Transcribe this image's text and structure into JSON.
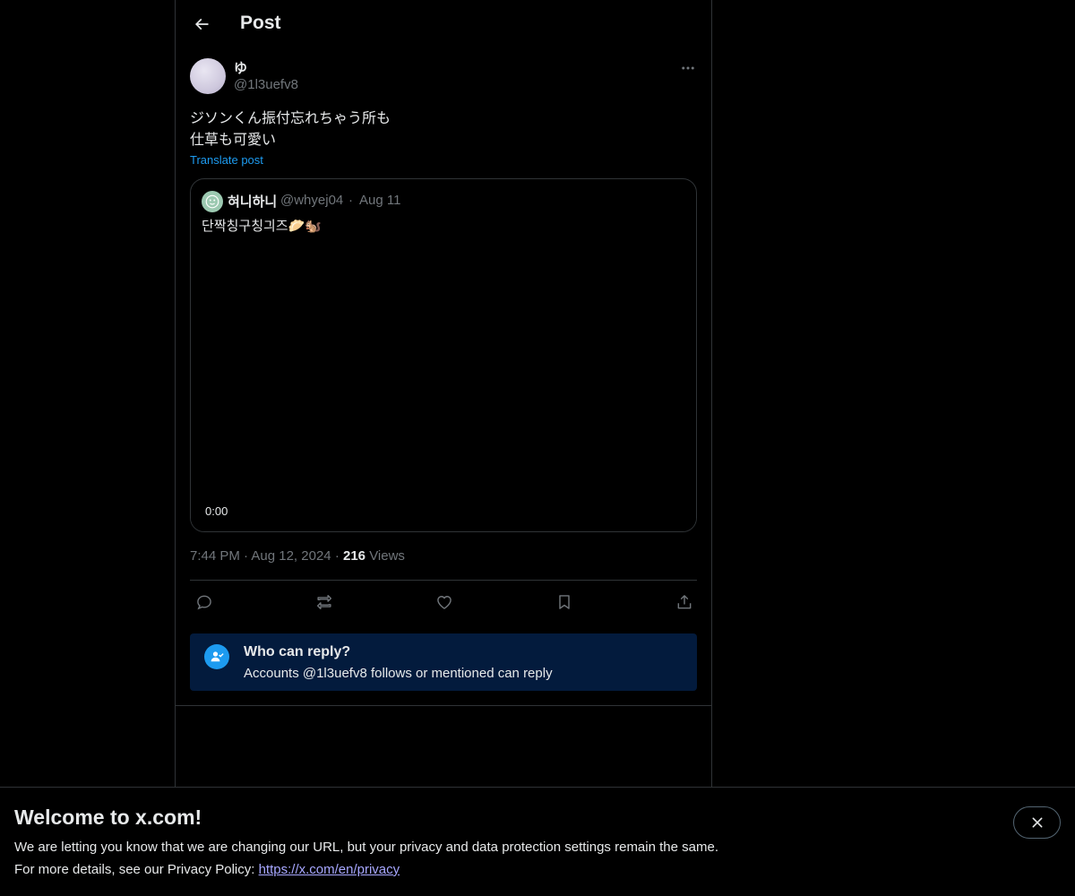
{
  "header": {
    "title": "Post",
    "back_icon": "arrow-left-icon"
  },
  "post": {
    "author_name": "ゆ",
    "author_handle": "@1l3uefv8",
    "text": "ジソンくん振付忘れちゃう所も\n仕草も可愛い",
    "translate_label": "Translate post",
    "time": "7:44 PM",
    "date": "Aug 12, 2024",
    "views_count": "216",
    "views_label": "Views"
  },
  "quote": {
    "author_name": "혀니하니",
    "author_handle": "@whyej04",
    "separator": "·",
    "date": "Aug 11",
    "text": "단짝칭구칭긔즈🥟🐿️",
    "video_time": "0:00"
  },
  "actions": [
    "reply-icon",
    "repost-icon",
    "like-icon",
    "bookmark-icon",
    "share-icon"
  ],
  "reply_restriction": {
    "title": "Who can reply?",
    "subtitle": "Accounts @1l3uefv8 follows or mentioned can reply"
  },
  "banner": {
    "title": "Welcome to x.com!",
    "line1": "We are letting you know that we are changing our URL, but your privacy and data protection settings remain the same.",
    "line2_prefix": "For more details, see our Privacy Policy: ",
    "link_text": "https://x.com/en/privacy"
  },
  "colors": {
    "background": "#000000",
    "text": "#e7e9ea",
    "muted": "#71767b",
    "accent": "#1d9bf0",
    "border": "#2f3336",
    "reply_box": "#031b3d"
  }
}
